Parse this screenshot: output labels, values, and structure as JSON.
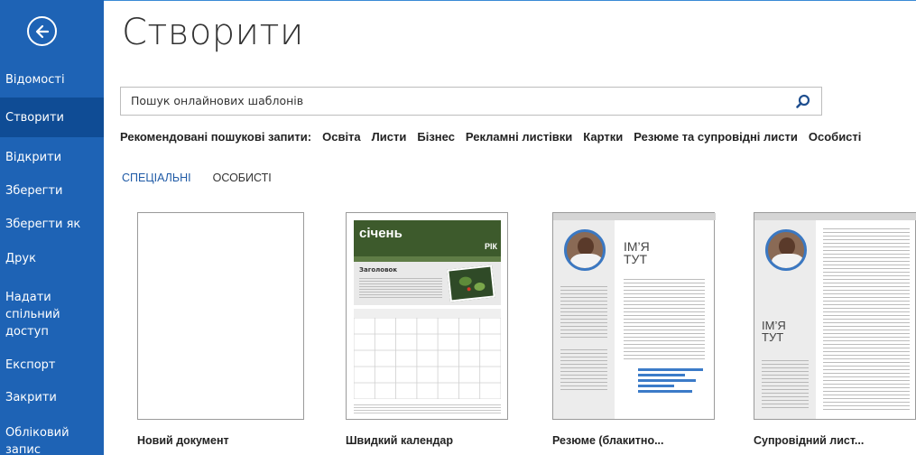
{
  "sidebar": {
    "items": [
      {
        "label": "Відомості"
      },
      {
        "label": "Створити"
      },
      {
        "label": "Відкрити"
      },
      {
        "label": "Зберегти"
      },
      {
        "label": "Зберегти як"
      },
      {
        "label": "Друк"
      },
      {
        "label": "Надати\nспільний\nдоступ"
      },
      {
        "label": "Експорт"
      },
      {
        "label": "Закрити"
      },
      {
        "label": "Обліковий запис"
      }
    ],
    "active_index": 1,
    "colors": {
      "background": "#1e63b5",
      "active": "#0f4c95"
    }
  },
  "page": {
    "title": "Створити"
  },
  "search": {
    "placeholder": "Пошук онлайнових шаблонів",
    "icon": "search-icon"
  },
  "suggested": {
    "label": "Рекомендовані пошукові запити:",
    "items": [
      "Освіта",
      "Листи",
      "Бізнес",
      "Рекламні листівки",
      "Картки",
      "Резюме та супровідні листи",
      "Особисті"
    ]
  },
  "tabs": [
    {
      "label": "СПЕЦІАЛЬНІ",
      "active": true
    },
    {
      "label": "ОСОБИСТІ",
      "active": false
    }
  ],
  "templates": [
    {
      "label": "Новий документ"
    },
    {
      "label": "Швидкий календар",
      "thumb": {
        "month": "січень",
        "year": "РІК",
        "heading": "Заголовок"
      }
    },
    {
      "label": "Резюме (блакитно...",
      "thumb": {
        "name": "ІМ’Я\nТУТ"
      }
    },
    {
      "label": "Супровідний лист...",
      "thumb": {
        "name": "ІМ’Я\nТУТ"
      }
    }
  ]
}
